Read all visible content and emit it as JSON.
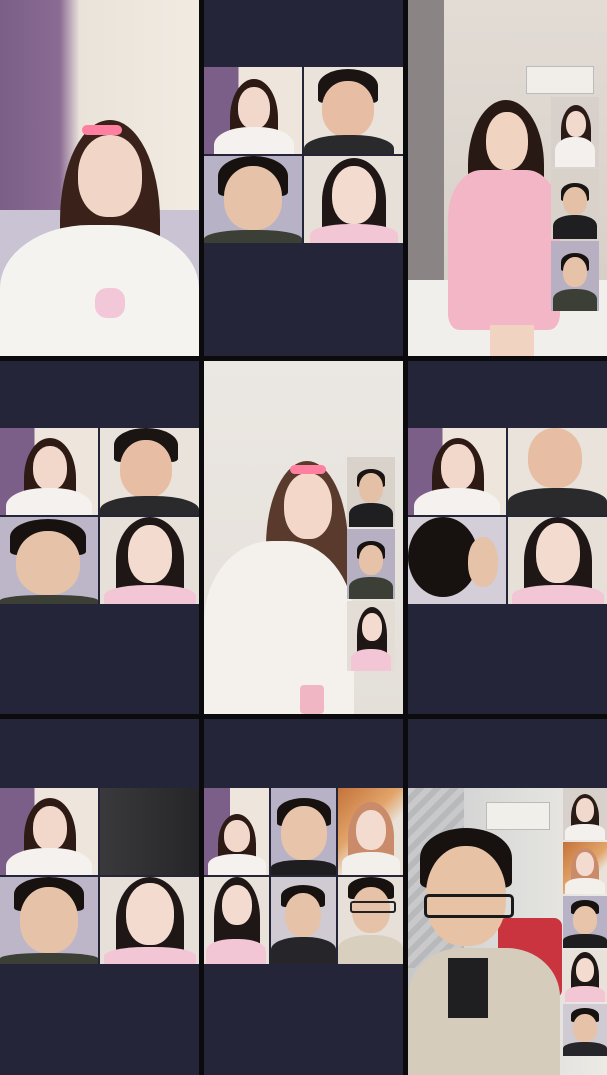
{
  "grid": {
    "cells": [
      {
        "id": "c1",
        "layout": "single",
        "tiles": [
          "room-lilac"
        ]
      },
      {
        "id": "c2",
        "layout": "quad",
        "tiles": [
          "girl-dark-hair",
          "man-grey-shirt",
          "man-black-tee",
          "girl-pink-top"
        ]
      },
      {
        "id": "c3",
        "layout": "main-plus-side",
        "tiles": [
          "dancer-pink-sweater",
          "side-girl",
          "side-man",
          "side-man-2"
        ]
      },
      {
        "id": "c4",
        "layout": "quad",
        "tiles": [
          "girl-waving",
          "man-smiling",
          "man-laughing",
          "girl-smiling"
        ]
      },
      {
        "id": "c5",
        "layout": "main-plus-side",
        "tiles": [
          "girl-shush",
          "side-man",
          "side-man-2",
          "side-girl"
        ]
      },
      {
        "id": "c6",
        "layout": "quad",
        "tiles": [
          "girl-hand-chin",
          "man-hand-face",
          "man-back-head",
          "girl-smiling"
        ]
      },
      {
        "id": "c7",
        "layout": "quad",
        "tiles": [
          "girl-lilac",
          "dark-shirt",
          "man-serious",
          "girl-pout"
        ]
      },
      {
        "id": "c8",
        "layout": "six",
        "tiles": [
          "girl-lilac",
          "man-smiling",
          "girl-auburn",
          "girl-pink",
          "man-hand-head",
          "man-glasses"
        ]
      },
      {
        "id": "c9",
        "layout": "main-plus-side",
        "tiles": [
          "man-glasses-jacket",
          "side-girl",
          "side-girl-2",
          "side-man",
          "side-girl-3",
          "side-man-2"
        ]
      }
    ]
  }
}
